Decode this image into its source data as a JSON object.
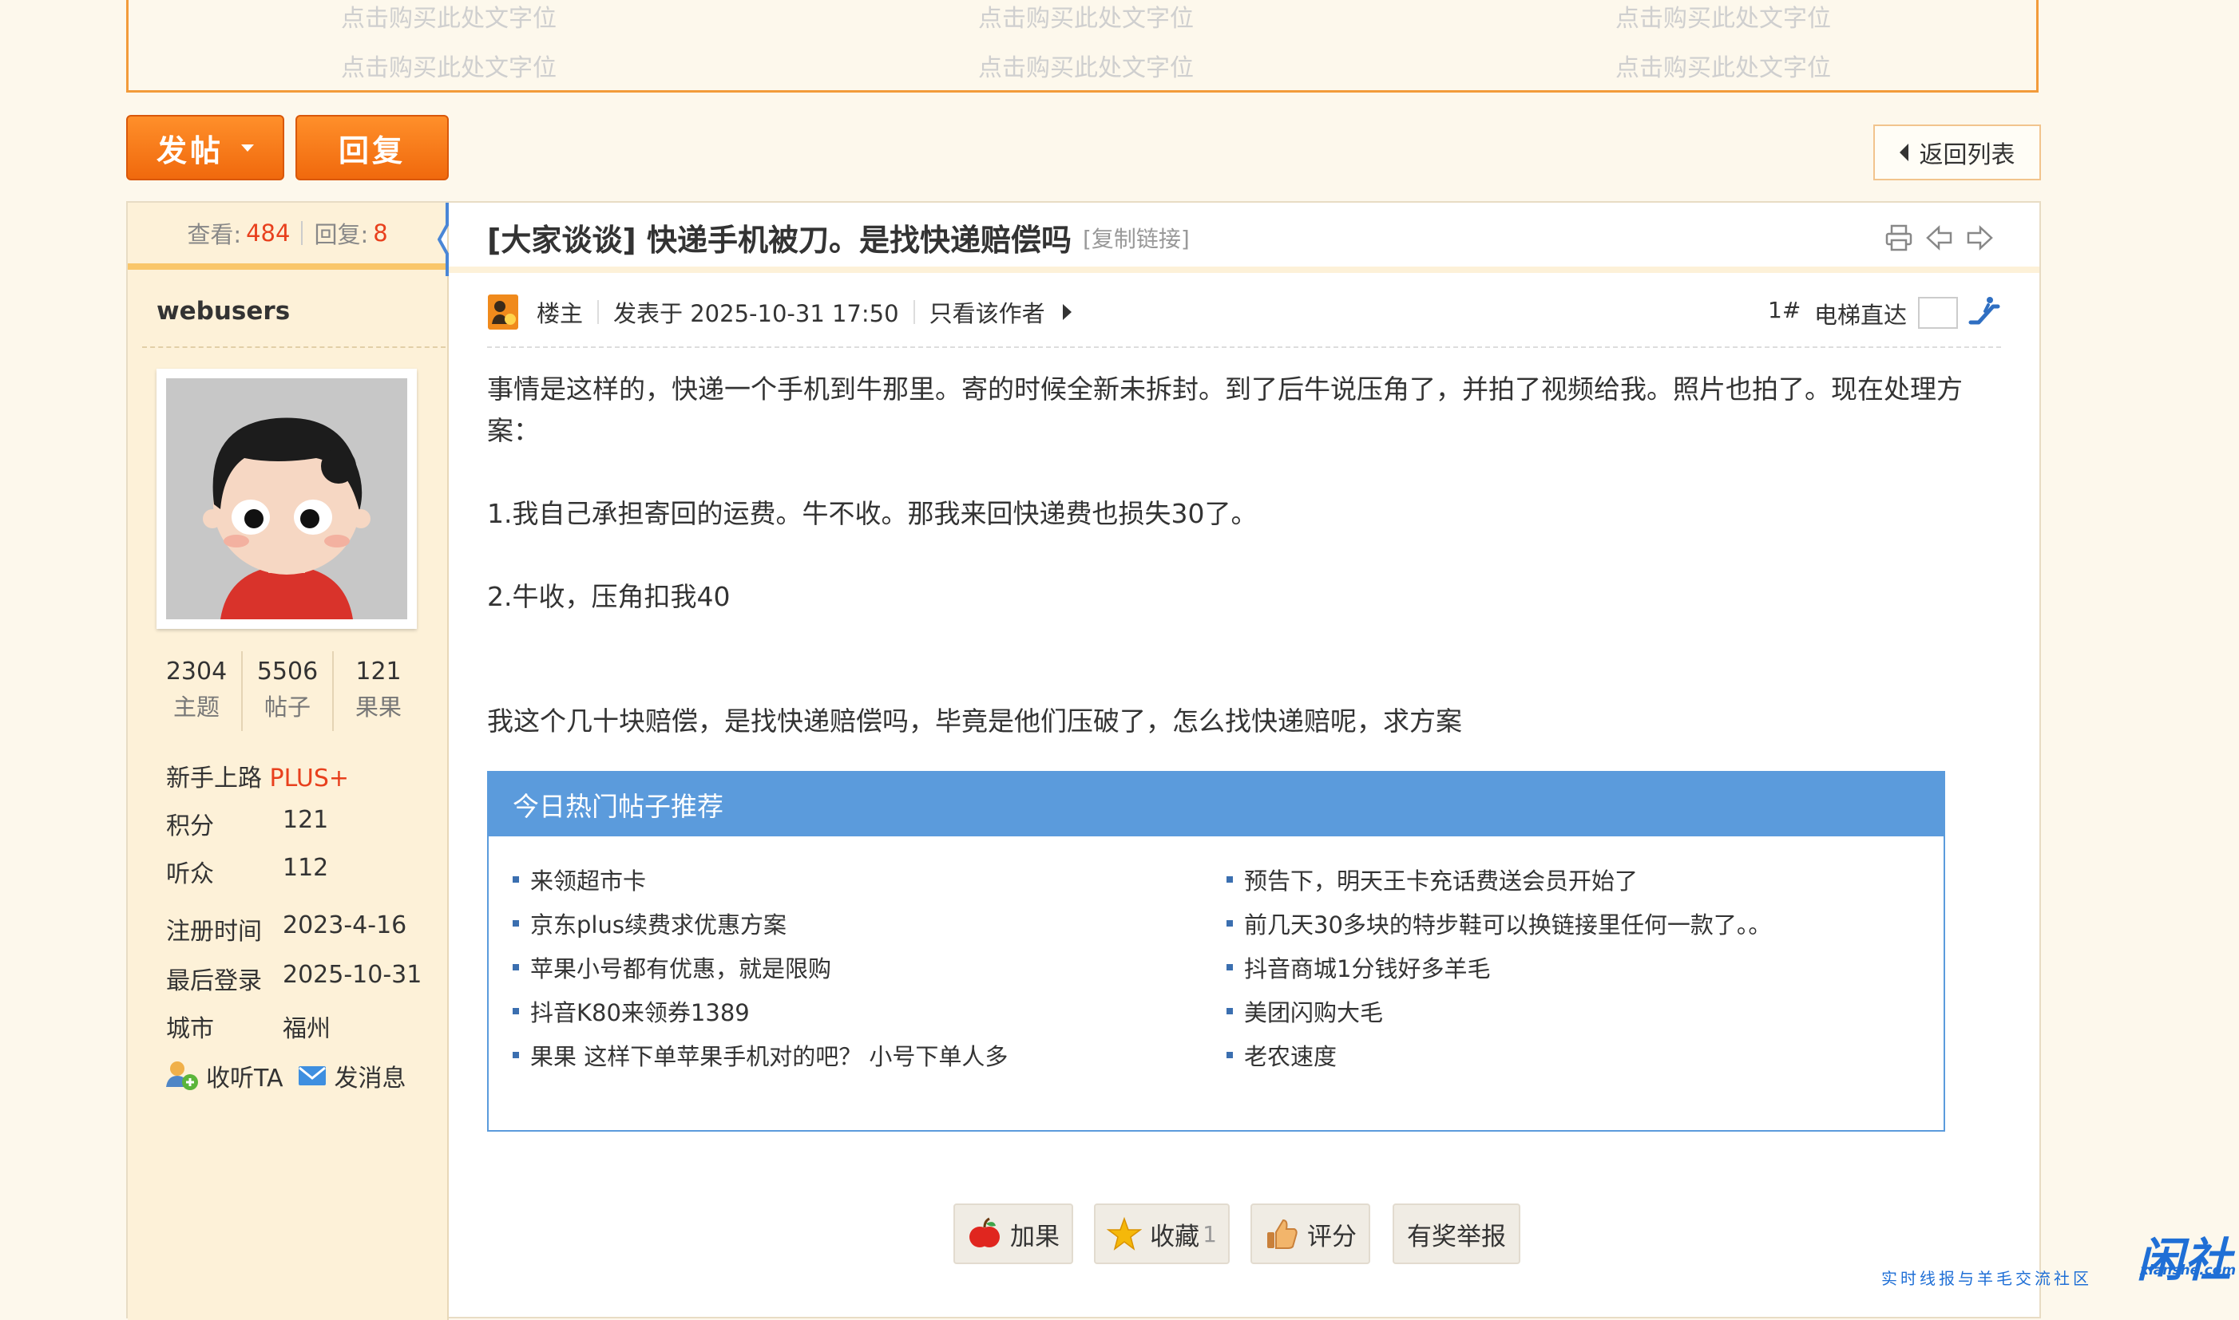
{
  "ad": {
    "cells": [
      "点击购买此处文字位",
      "点击购买此处文字位",
      "点击购买此处文字位",
      "点击购买此处文字位",
      "点击购买此处文字位",
      "点击购买此处文字位"
    ]
  },
  "toolbar": {
    "post_label": "发帖",
    "reply_label": "回复",
    "back_label": "返回列表"
  },
  "thread": {
    "views_label": "查看:",
    "views": "484",
    "replies_label": "回复:",
    "replies": "8",
    "title": "[大家谈谈] 快递手机被刀。是找快递赔偿吗",
    "copy_link": "[复制链接]"
  },
  "author": {
    "name": "webusers",
    "stats": [
      {
        "value": "2304",
        "label": "主题"
      },
      {
        "value": "5506",
        "label": "帖子"
      },
      {
        "value": "121",
        "label": "果果"
      }
    ],
    "group": "新手上路",
    "group_badge": "PLUS+",
    "info": [
      {
        "label": "积分",
        "value": "121"
      },
      {
        "label": "听众",
        "value": "112"
      },
      {
        "label": "注册时间",
        "value": "2023-4-16"
      },
      {
        "label": "最后登录",
        "value": "2025-10-31"
      },
      {
        "label": "城市",
        "value": "福州"
      }
    ],
    "follow_label": "收听TA",
    "message_label": "发消息"
  },
  "post": {
    "role": "楼主",
    "posted": "发表于 2025-10-31 17:50",
    "only_author": "只看该作者",
    "floor": "1#",
    "elevator": "电梯直达",
    "paragraphs": [
      "事情是这样的，快递一个手机到牛那里。寄的时候全新未拆封。到了后牛说压角了，并拍了视频给我。照片也拍了。现在处理方案：",
      "1.我自己承担寄回的运费。牛不收。那我来回快递费也损失30了。",
      "2.牛收，压角扣我40",
      "我这个几十块赔偿，是找快递赔偿吗，毕竟是他们压破了，怎么找快递赔呢，求方案"
    ]
  },
  "hot": {
    "title": "今日热门帖子推荐",
    "items": [
      "来领超市卡",
      "预告下，明天王卡充话费送会员开始了",
      "京东plus续费求优惠方案",
      "前几天30多块的特步鞋可以换链接里任何一款了。。",
      "苹果小号都有优惠，就是限购",
      "抖音商城1分钱好多羊毛",
      "抖音K80来领券1389",
      "美团闪购大毛",
      "果果 这样下单苹果手机对的吧？ 小号下单人多",
      "老农速度"
    ]
  },
  "actions": {
    "add_fruit": "加果",
    "favorite": "收藏",
    "favorite_count": "1",
    "rate": "评分",
    "report": "有奖举报"
  },
  "watermark": {
    "logo": "闲社",
    "url": "xianshe.com",
    "tagline": "实时线报与羊毛交流社区"
  },
  "colors": {
    "accent": "#f0690d",
    "hot_blue": "#5b9bdc",
    "highlight": "#e8401d",
    "sidebar_bg": "#fdf1d8"
  }
}
